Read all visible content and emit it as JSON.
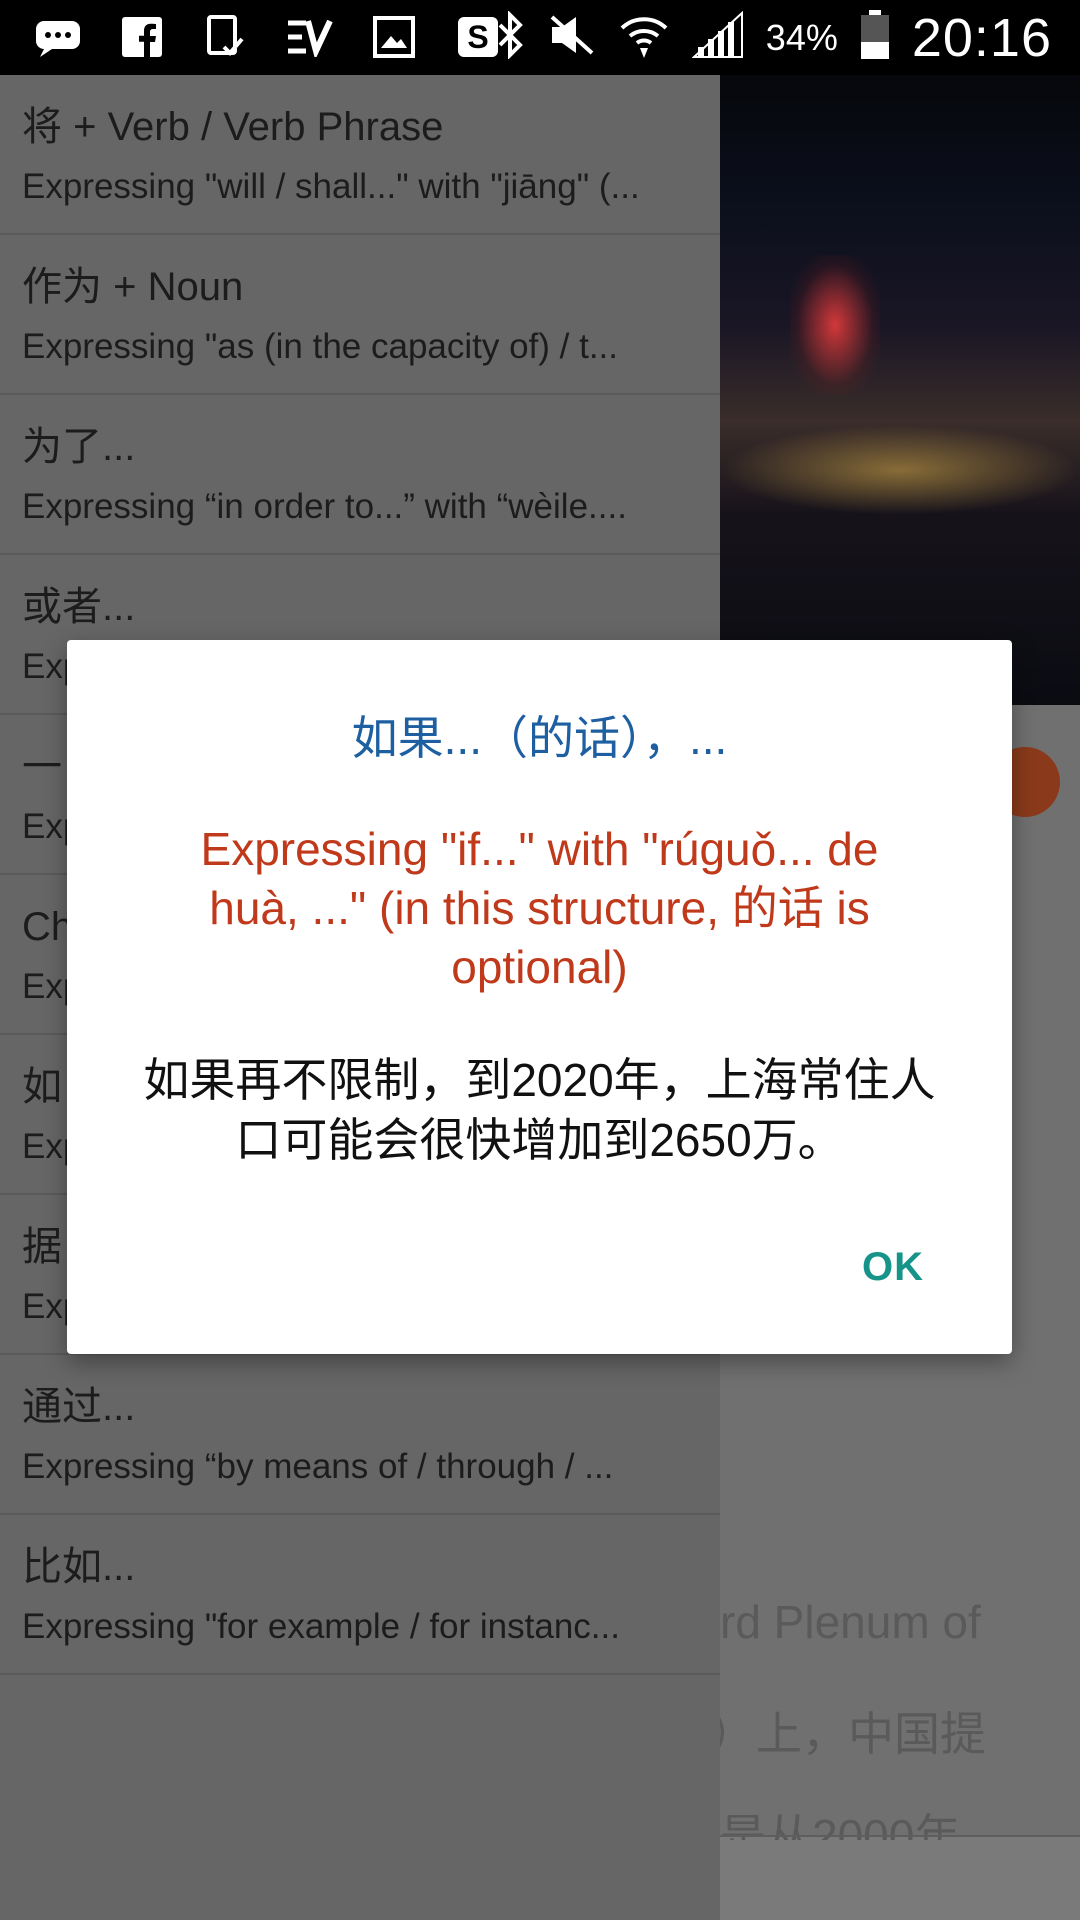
{
  "status_bar": {
    "icons_left": [
      "message-icon",
      "facebook-icon",
      "document-icon",
      "app-icon",
      "gallery-icon",
      "skype-icon"
    ],
    "icons_right": [
      "bluetooth-icon",
      "mute-icon",
      "wifi-icon",
      "signal-icon",
      "battery-icon"
    ],
    "battery": "34%",
    "time": "20:16"
  },
  "drawer": {
    "items": [
      {
        "title": "将 + Verb / Verb Phrase",
        "subtitle": "Expressing \"will / shall...\" with \"jiāng\" (..."
      },
      {
        "title": "作为 + Noun",
        "subtitle": "Expressing \"as (in the capacity of) / t..."
      },
      {
        "title": "为了...",
        "subtitle": "Expressing “in order to...” with “wèile...."
      },
      {
        "title": "或者...",
        "subtitle": "Exp"
      },
      {
        "title": "一",
        "subtitle": "Exp"
      },
      {
        "title": "Ch",
        "subtitle": "Exp"
      },
      {
        "title": "如",
        "subtitle": "Exp"
      },
      {
        "title": "据",
        "subtitle": "Exp"
      },
      {
        "title": "通过...",
        "subtitle": "Expressing “by means of / through / ..."
      },
      {
        "title": "比如...",
        "subtitle": "Expressing \"for example / for instanc..."
      }
    ]
  },
  "background": {
    "text_lines": [
      "rd Plenum of",
      "）上，中国提",
      "是从2000年"
    ]
  },
  "dialog": {
    "title": "如果...（的话），...",
    "description": "Expressing \"if...\" with \"rúguǒ... de huà, ...\" (in this structure, 的话 is optional)",
    "example": "如果再不限制，到2020年，上海常住人口可能会很快增加到2650万。",
    "ok_label": "OK"
  },
  "colors": {
    "title": "#1d5fa1",
    "description": "#c0391b",
    "ok": "#17948a"
  }
}
